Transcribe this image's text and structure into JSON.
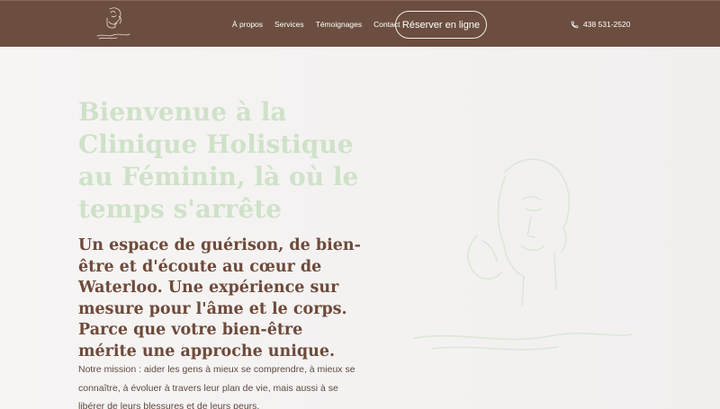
{
  "header": {
    "nav": [
      "À propos",
      "Services",
      "Témoignages",
      "Contact"
    ],
    "cta_label": "Réserver en ligne",
    "phone": "438 531-2520"
  },
  "hero": {
    "title": "Bienvenue à la Clinique Holistique au Féminin, là où le temps s'arrête",
    "subtitle": "Un espace de guérison, de bien-être et d'écoute au cœur de Waterloo. Une expérience sur mesure pour l'âme et le corps. Parce que votre bien-être mérite une approche unique.",
    "mission": "Notre mission : aider les gens à mieux se comprendre, à mieux se connaître, à évoluer à travers leur plan de vie, mais aussi à se libérer de leurs blessures et de leurs peurs."
  },
  "colors": {
    "header_bg": "#6b4e3f",
    "title": "#cfe2c9",
    "subtitle": "#6e4a3a",
    "body_text": "#5b4a42"
  },
  "icons": {
    "logo": "woman-line-art-logo",
    "phone": "phone-icon",
    "hero_art": "woman-face-line-art"
  }
}
